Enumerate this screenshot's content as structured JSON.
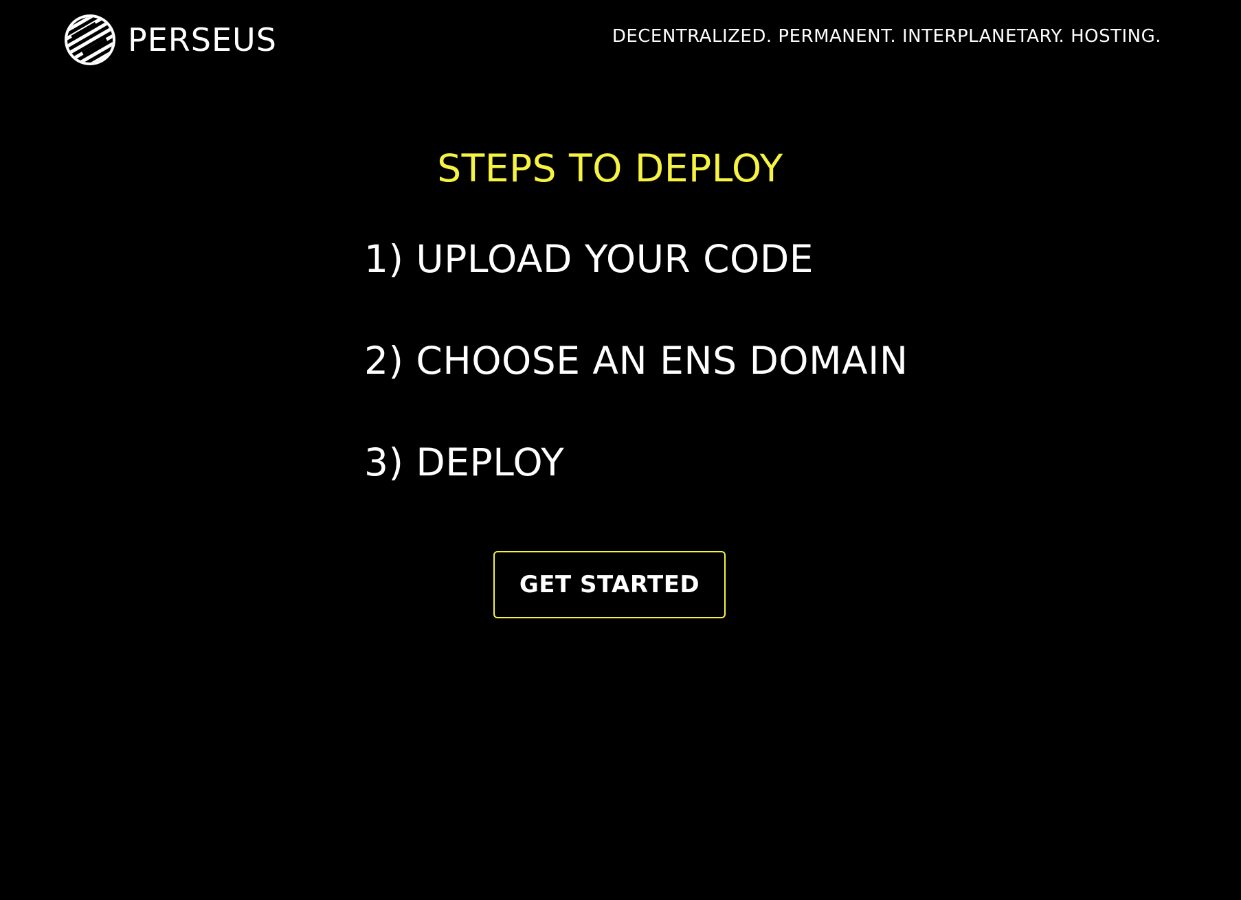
{
  "header": {
    "brand_name": "PERSEUS",
    "logo_icon": "perseus-globe-logo",
    "tagline": "DECENTRALIZED. PERMANENT. INTERPLANETARY. HOSTING."
  },
  "main": {
    "title": "STEPS TO DEPLOY",
    "steps": [
      {
        "label": "1) UPLOAD YOUR CODE"
      },
      {
        "label": "2) CHOOSE AN ENS DOMAIN"
      },
      {
        "label": "3) DEPLOY"
      }
    ],
    "cta_label": "GET STARTED"
  },
  "colors": {
    "background": "#000000",
    "accent": "#f6f341",
    "text": "#ffffff"
  }
}
